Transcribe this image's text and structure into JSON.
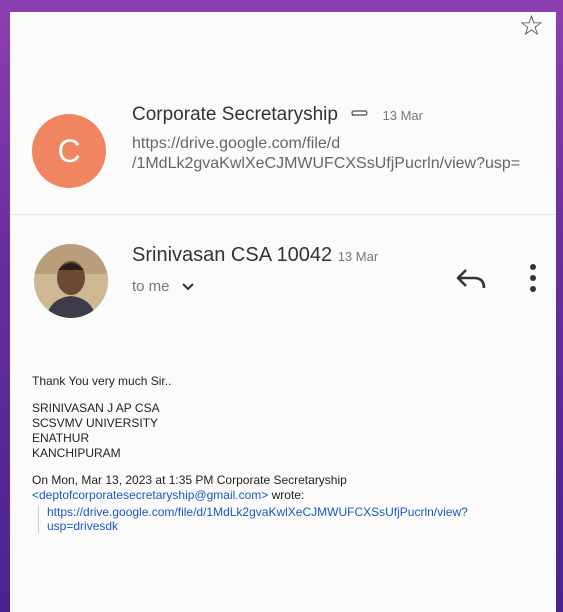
{
  "header": {
    "star_icon": "star-outline-icon"
  },
  "collapsed_message": {
    "avatar_letter": "C",
    "avatar_color": "#ef8661",
    "sender": "Corporate Secretaryship",
    "attachment_icon": "paperclip-icon",
    "date": "13 Mar",
    "snippet_line1": "https://drive.google.com/file/d",
    "snippet_line2": "/1MdLk2gvaKwlXeCJMWUFCXSsUfjPucrln/view?usp="
  },
  "expanded_message": {
    "sender": "Srinivasan CSA 10042",
    "date": "13 Mar",
    "to_label": "to me",
    "reply_icon": "reply-icon",
    "more_icon": "more-vert-icon"
  },
  "body": {
    "greeting": "Thank You very much Sir..",
    "signature": [
      "SRINIVASAN J AP CSA",
      "SCSVMV UNIVERSITY",
      "ENATHUR",
      "KANCHIPURAM"
    ],
    "quote_header": "On Mon, Mar 13, 2023 at 1:35 PM Corporate Secretaryship",
    "quote_email": "<deptofcorporatesecretaryship@gmail.com>",
    "quote_wrote": " wrote:",
    "quoted_link_line1": "https://drive.google.com/file/d/1MdLk2gvaKwlXeCJMWUFCXSsUfjPucrln/view?",
    "quoted_link_line2": "usp=drivesdk"
  }
}
